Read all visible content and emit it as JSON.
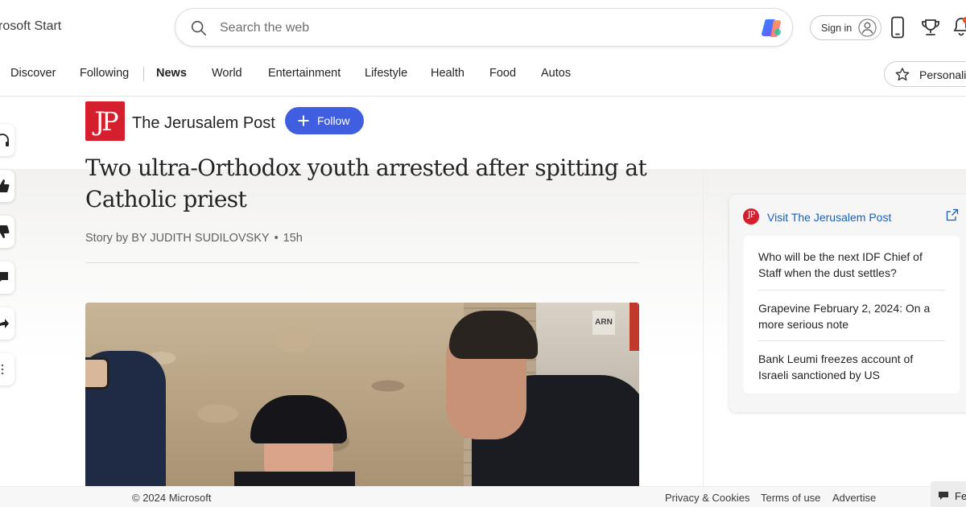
{
  "header": {
    "brand": "rosoft Start",
    "search_placeholder": "Search the web",
    "sign_in_label": "Sign in"
  },
  "nav": {
    "items": [
      {
        "label": "Discover"
      },
      {
        "label": "Following"
      },
      {
        "label": "News"
      },
      {
        "label": "World"
      },
      {
        "label": "Entertainment"
      },
      {
        "label": "Lifestyle"
      },
      {
        "label": "Health"
      },
      {
        "label": "Food"
      },
      {
        "label": "Autos"
      }
    ],
    "active": "News",
    "personalize_label": "Personaliz"
  },
  "article": {
    "publisher_logo_text": "JP",
    "publisher": "The Jerusalem Post",
    "follow_label": "Follow",
    "headline": "Two ultra-Orthodox youth arrested after spitting at Catholic priest",
    "byline": "Story by BY JUDITH SUDILOVSKY",
    "age": "15h",
    "image_sign_text": "ARN"
  },
  "sidebar_card": {
    "logo_text": "JP",
    "visit_label": "Visit The Jerusalem Post",
    "items": [
      {
        "title": "Who will be the next IDF Chief of Staff when the dust settles?"
      },
      {
        "title": "Grapevine February 2, 2024: On a more serious note"
      },
      {
        "title": "Bank Leumi freezes account of Israeli sanctioned by US"
      }
    ]
  },
  "footer": {
    "copyright": "© 2024 Microsoft",
    "links": [
      {
        "label": "Privacy & Cookies"
      },
      {
        "label": "Terms of use"
      },
      {
        "label": "Advertise"
      }
    ],
    "feedback_label": "Fe"
  },
  "colors": {
    "accent_blue": "#3f5fe0",
    "link_blue": "#1a60b8",
    "publisher_red": "#d61f2e"
  },
  "icons": [
    "search-icon",
    "copilot-icon",
    "user-icon",
    "phone-icon",
    "trophy-icon",
    "bell-icon",
    "star-icon",
    "plus-icon",
    "external-link-icon",
    "headphones-icon",
    "thumbs-up-icon",
    "thumbs-down-icon",
    "comment-icon",
    "share-icon",
    "more-icon",
    "feedback-icon"
  ]
}
